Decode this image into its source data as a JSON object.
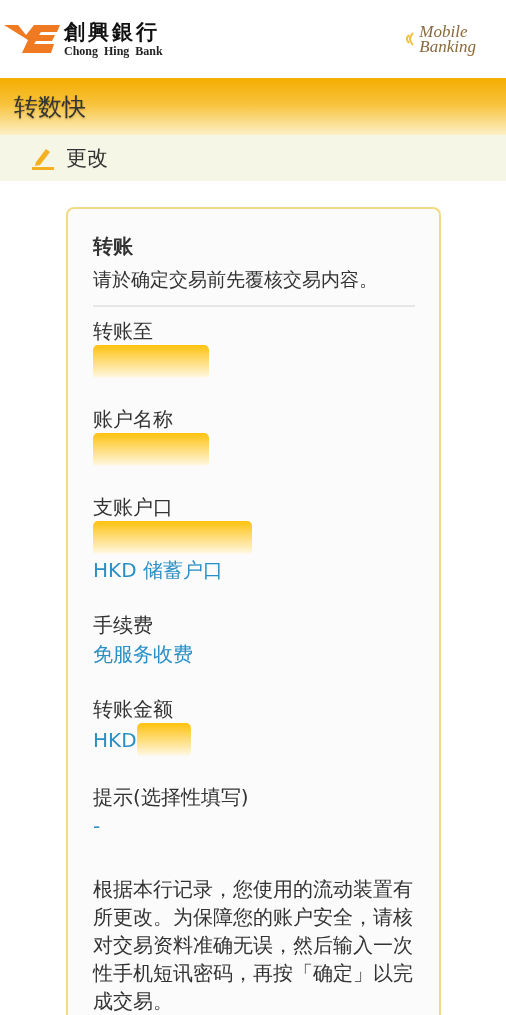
{
  "header": {
    "bank_name": "創興銀行",
    "bank_name_en": "Chong Hing Bank",
    "app_logo": [
      "Mobile",
      "Banking"
    ]
  },
  "title_bar": {
    "title": "转数快"
  },
  "edit_bar": {
    "label": "更改"
  },
  "card": {
    "title": "转账",
    "subtitle": "请於确定交易前先覆核交易内容。",
    "fields": [
      {
        "label": "转账至",
        "lines": [
          [
            {
              "kind": "redacted-short"
            }
          ]
        ]
      },
      {
        "label": "账户名称",
        "lines": [
          [
            {
              "kind": "redacted-short"
            }
          ]
        ]
      },
      {
        "label": "支账户口",
        "lines": [
          [
            {
              "kind": "redacted-long"
            }
          ],
          [
            {
              "kind": "text",
              "text": "HKD 储蓄户口"
            }
          ]
        ]
      },
      {
        "label": "手续费",
        "lines": [
          [
            {
              "kind": "text",
              "text": "免服务收费"
            }
          ]
        ]
      },
      {
        "label": "转账金额",
        "lines": [
          [
            {
              "kind": "text",
              "text": "HKD"
            },
            {
              "kind": "redacted-tiny"
            }
          ]
        ]
      },
      {
        "label": "提示(选择性填写)",
        "lines": [
          [
            {
              "kind": "text",
              "text": "-"
            }
          ]
        ]
      }
    ],
    "notice": "根据本行记录，您使用的流动装置有所更改。为保障您的账户安全，请核对交易资料准确无误，然后输入一次性手机短讯密码，再按「确定」以完成交易。"
  }
}
